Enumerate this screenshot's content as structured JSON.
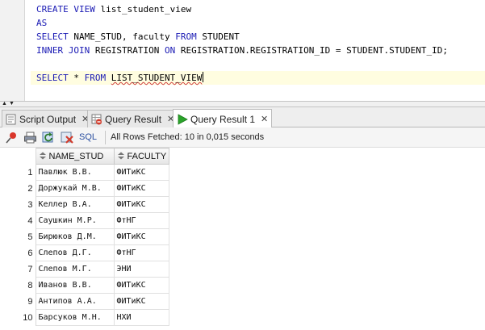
{
  "editor": {
    "lines": [
      [
        {
          "t": "CREATE VIEW ",
          "k": true
        },
        {
          "t": "list_student_view",
          "k": false
        }
      ],
      [
        {
          "t": "AS",
          "k": true
        }
      ],
      [
        {
          "t": "SELECT ",
          "k": true
        },
        {
          "t": "NAME_STUD, faculty ",
          "k": false
        },
        {
          "t": "FROM ",
          "k": true
        },
        {
          "t": "STUDENT",
          "k": false
        }
      ],
      [
        {
          "t": "INNER JOIN ",
          "k": true
        },
        {
          "t": "REGISTRATION ",
          "k": false
        },
        {
          "t": "ON ",
          "k": true
        },
        {
          "t": "REGISTRATION.REGISTRATION_ID = STUDENT.STUDENT_ID;",
          "k": false
        }
      ],
      [],
      [
        {
          "t": "SELECT ",
          "k": true
        },
        {
          "t": "* ",
          "k": false
        },
        {
          "t": "FROM ",
          "k": true
        },
        {
          "t": "LIST_STUDENT_VIEW",
          "k": false,
          "squiggle": true
        }
      ]
    ]
  },
  "tabs": [
    {
      "label": "Script Output",
      "icon": "script-output-icon",
      "active": false
    },
    {
      "label": "Query Result",
      "icon": "query-result-icon",
      "active": false
    },
    {
      "label": "Query Result 1",
      "icon": "run-icon",
      "active": true
    }
  ],
  "toolbar": {
    "sql_label": "SQL",
    "status": "All Rows Fetched: 10 in 0,015 seconds"
  },
  "grid": {
    "columns": [
      "NAME_STUD",
      "FACULTY"
    ],
    "rows": [
      [
        "1",
        "Павлюк В.В.",
        "ФИТиКС"
      ],
      [
        "2",
        "Доржукай М.В.",
        "ФИТиКС"
      ],
      [
        "3",
        "Келлер В.А.",
        "ФИТиКС"
      ],
      [
        "4",
        "Саушкин М.Р.",
        "ФтНГ"
      ],
      [
        "5",
        "Бирюков Д.М.",
        "ФИТиКС"
      ],
      [
        "6",
        "Слепов Д.Г.",
        "ФтНГ"
      ],
      [
        "7",
        "Слепов М.Г.",
        "ЭНИ"
      ],
      [
        "8",
        "Иванов В.В.",
        "ФИТиКС"
      ],
      [
        "9",
        "Антипов А.А.",
        "ФИТиКС"
      ],
      [
        "10",
        "Барсуков М.Н.",
        "НХИ"
      ]
    ]
  }
}
